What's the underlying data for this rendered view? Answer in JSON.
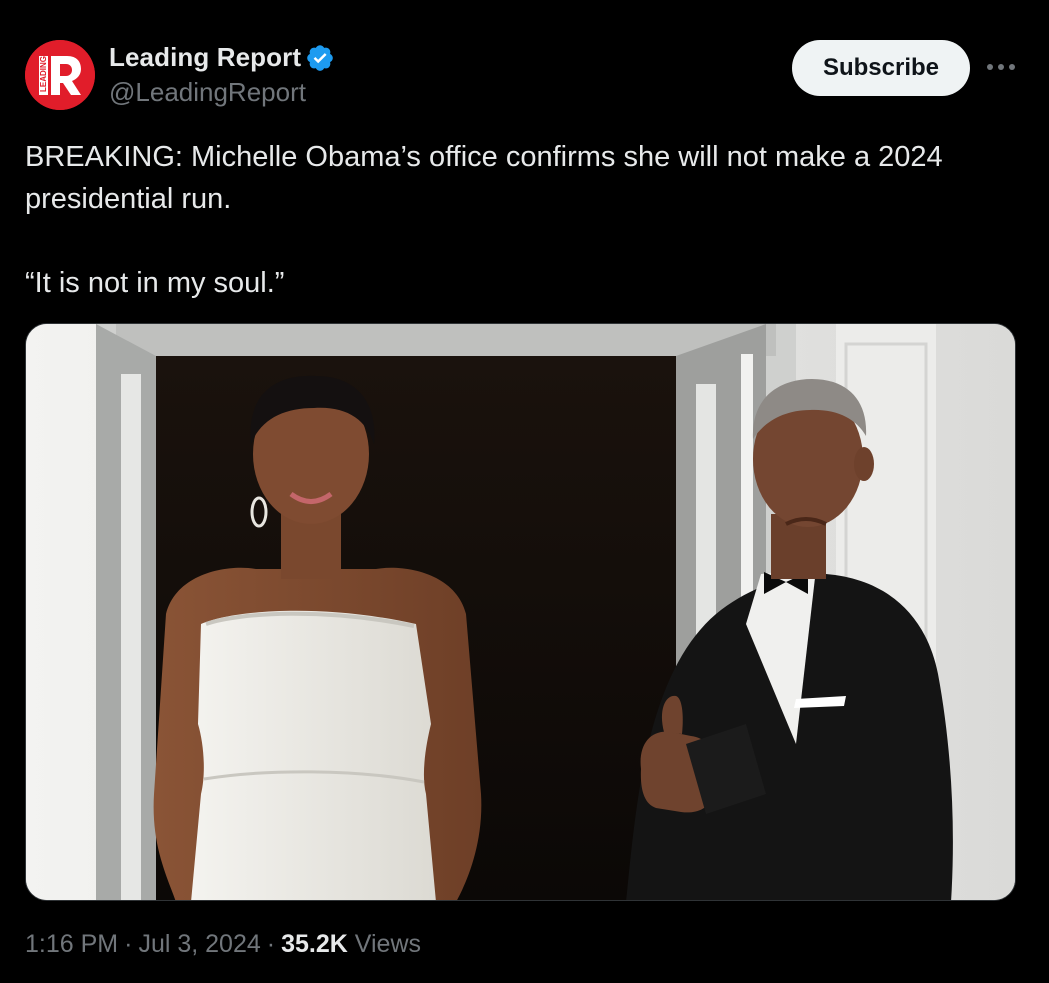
{
  "author": {
    "name": "Leading Report",
    "handle": "@LeadingReport",
    "avatar_letter": "R",
    "avatar_text": "LEADING",
    "verified": true,
    "brand_color": "#e11d2a",
    "verified_color": "#1d9bf0"
  },
  "actions": {
    "subscribe_label": "Subscribe",
    "more_icon": "ellipsis-icon"
  },
  "tweet": {
    "line1": "BREAKING: Michelle Obama’s office confirms she will not make a 2024 presidential run.",
    "line2": "“It is not in my soul.”"
  },
  "media": {
    "type": "photo"
  },
  "meta": {
    "time": "1:16 PM",
    "date": "Jul 3, 2024",
    "separator": "·",
    "views_count": "35.2K",
    "views_label": "Views"
  },
  "colors": {
    "background": "#000000",
    "text_primary": "#e7e9ea",
    "text_secondary": "#71767b",
    "button_bg": "#eff3f4"
  }
}
